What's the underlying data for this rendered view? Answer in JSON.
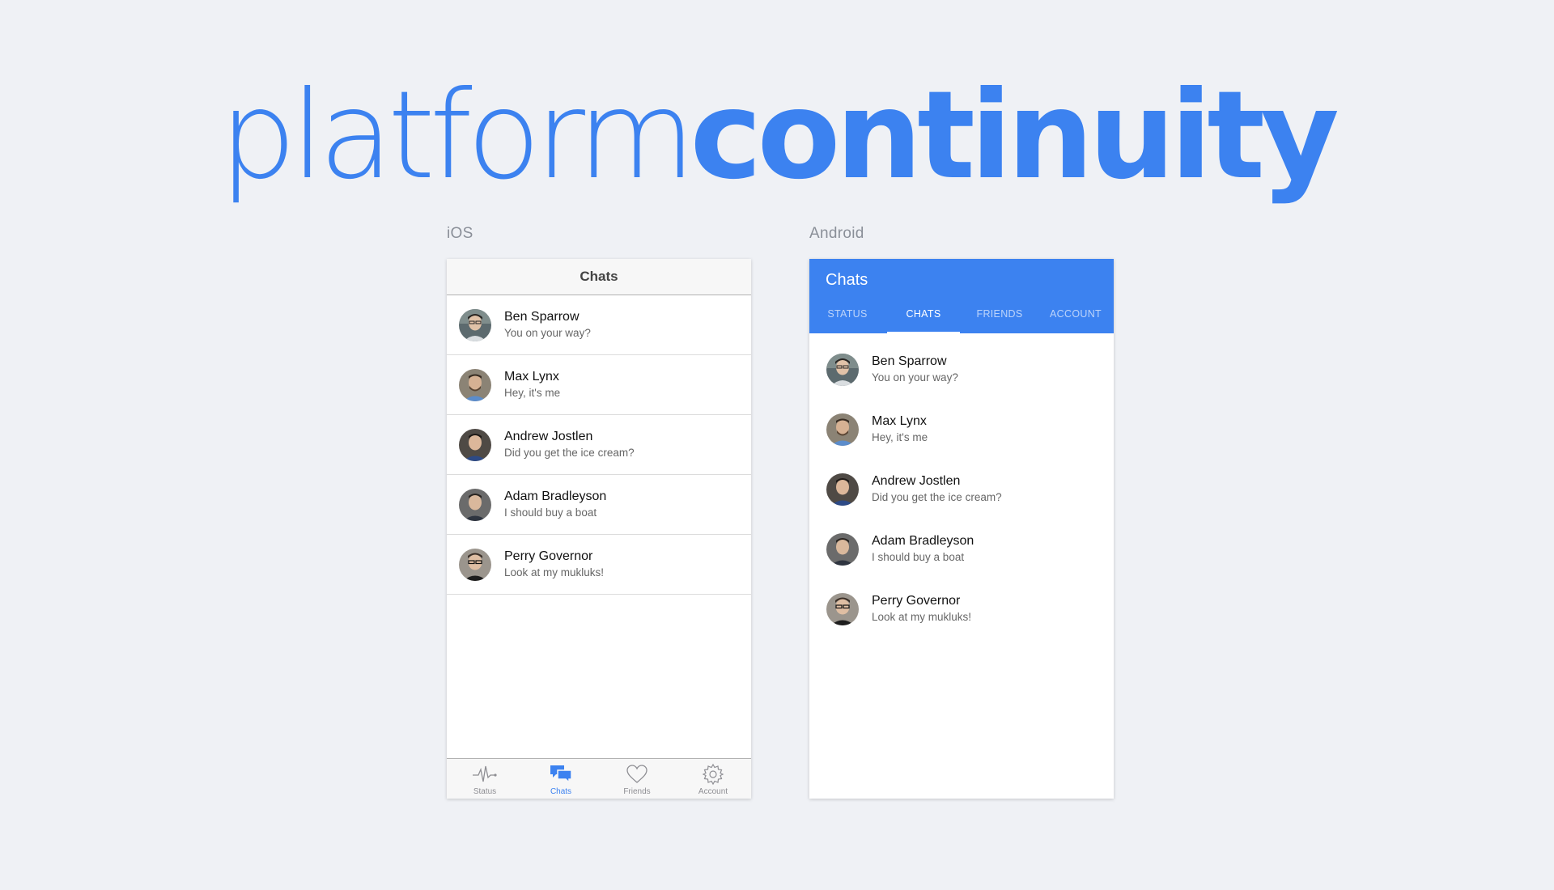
{
  "headline": {
    "light": "platform",
    "bold": "continuity"
  },
  "labels": {
    "ios": "iOS",
    "android": "Android"
  },
  "colors": {
    "accent": "#3c82f0",
    "background": "#eff1f5"
  },
  "ios": {
    "navbar_title": "Chats",
    "chats": [
      {
        "name": "Ben Sparrow",
        "message": "You on your way?"
      },
      {
        "name": "Max Lynx",
        "message": "Hey, it's me"
      },
      {
        "name": "Andrew Jostlen",
        "message": "Did you get the ice cream?"
      },
      {
        "name": "Adam Bradleyson",
        "message": "I should buy a boat"
      },
      {
        "name": "Perry Governor",
        "message": "Look at my mukluks!"
      }
    ],
    "tabs": [
      {
        "label": "Status",
        "icon": "pulse-icon"
      },
      {
        "label": "Chats",
        "icon": "chat-bubbles-icon",
        "active": true
      },
      {
        "label": "Friends",
        "icon": "heart-icon"
      },
      {
        "label": "Account",
        "icon": "gear-icon"
      }
    ]
  },
  "android": {
    "appbar_title": "Chats",
    "tabs": [
      {
        "label": "STATUS"
      },
      {
        "label": "CHATS",
        "active": true
      },
      {
        "label": "FRIENDS"
      },
      {
        "label": "ACCOUNT"
      }
    ],
    "chats": [
      {
        "name": "Ben Sparrow",
        "message": "You on your way?"
      },
      {
        "name": "Max Lynx",
        "message": "Hey, it's me"
      },
      {
        "name": "Andrew Jostlen",
        "message": "Did you get the ice cream?"
      },
      {
        "name": "Adam Bradleyson",
        "message": "I should buy a boat"
      },
      {
        "name": "Perry Governor",
        "message": "Look at my mukluks!"
      }
    ]
  }
}
